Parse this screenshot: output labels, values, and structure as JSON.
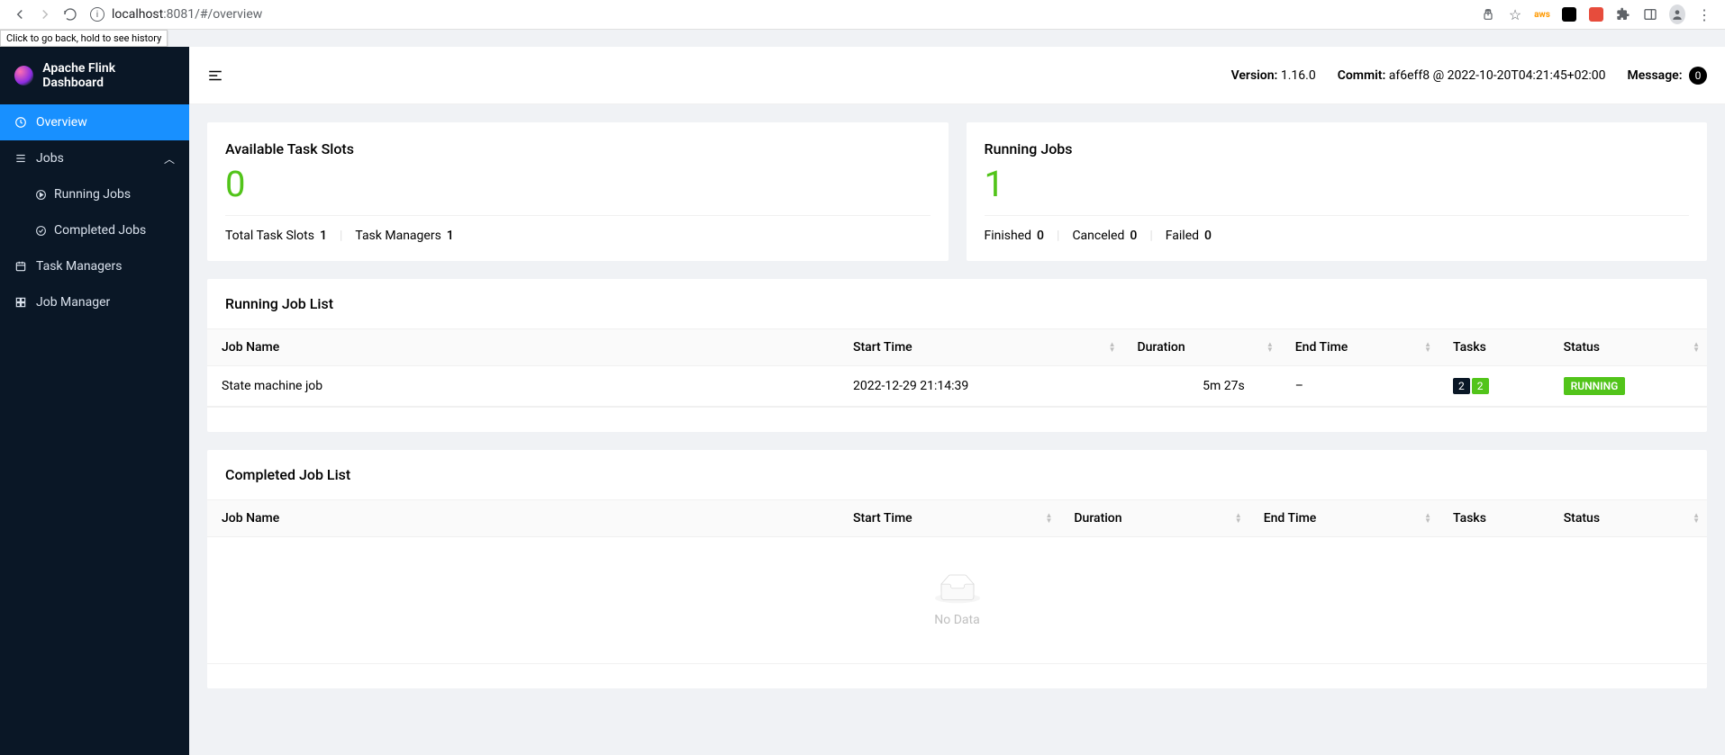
{
  "browser": {
    "url_host": "localhost",
    "url_rest": ":8081/#/overview",
    "back_tooltip": "Click to go back, hold to see history"
  },
  "sidebar": {
    "brand": "Apache Flink Dashboard",
    "items": {
      "overview": "Overview",
      "jobs": "Jobs",
      "running_jobs": "Running Jobs",
      "completed_jobs": "Completed Jobs",
      "task_managers": "Task Managers",
      "job_manager": "Job Manager"
    }
  },
  "topbar": {
    "version_label": "Version:",
    "version_value": "1.16.0",
    "commit_label": "Commit:",
    "commit_value": "af6eff8 @ 2022-10-20T04:21:45+02:00",
    "message_label": "Message:",
    "message_count": "0"
  },
  "cards": {
    "slots": {
      "title": "Available Task Slots",
      "value": "0",
      "total_label": "Total Task Slots",
      "total_value": "1",
      "managers_label": "Task Managers",
      "managers_value": "1"
    },
    "running": {
      "title": "Running Jobs",
      "value": "1",
      "finished_label": "Finished",
      "finished_value": "0",
      "canceled_label": "Canceled",
      "canceled_value": "0",
      "failed_label": "Failed",
      "failed_value": "0"
    }
  },
  "running_list": {
    "title": "Running Job List",
    "headers": {
      "name": "Job Name",
      "start": "Start Time",
      "duration": "Duration",
      "end": "End Time",
      "tasks": "Tasks",
      "status": "Status"
    },
    "row": {
      "name": "State machine job",
      "start": "2022-12-29 21:14:39",
      "duration": "5m 27s",
      "end": "–",
      "task_a": "2",
      "task_b": "2",
      "status": "RUNNING"
    }
  },
  "completed_list": {
    "title": "Completed Job List",
    "headers": {
      "name": "Job Name",
      "start": "Start Time",
      "duration": "Duration",
      "end": "End Time",
      "tasks": "Tasks",
      "status": "Status"
    },
    "empty": "No Data"
  }
}
